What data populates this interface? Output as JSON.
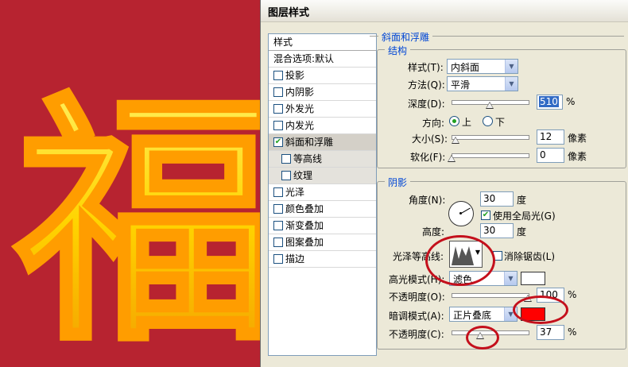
{
  "canvas": {
    "glyph": "福",
    "bg_color": "#b72330",
    "glyph_color": "#ffd400"
  },
  "dialog": {
    "title": "图层样式",
    "styles_list": {
      "header": "样式",
      "blend": "混合选项:默认",
      "items": [
        {
          "label": "投影",
          "checked": false
        },
        {
          "label": "内阴影",
          "checked": false
        },
        {
          "label": "外发光",
          "checked": false
        },
        {
          "label": "内发光",
          "checked": false
        },
        {
          "label": "斜面和浮雕",
          "checked": true
        },
        {
          "label": "等高线",
          "checked": false
        },
        {
          "label": "纹理",
          "checked": false
        },
        {
          "label": "光泽",
          "checked": false
        },
        {
          "label": "颜色叠加",
          "checked": false
        },
        {
          "label": "渐变叠加",
          "checked": false
        },
        {
          "label": "图案叠加",
          "checked": false
        },
        {
          "label": "描边",
          "checked": false
        }
      ]
    },
    "bevel": {
      "section_title": "斜面和浮雕",
      "structure_title": "结构",
      "style_label": "样式(T):",
      "style_value": "内斜面",
      "technique_label": "方法(Q):",
      "technique_value": "平滑",
      "depth_label": "深度(D):",
      "depth_value": "510",
      "depth_unit": "%",
      "depth_slider": 0.5,
      "direction_label": "方向:",
      "dir_up": "上",
      "dir_down": "下",
      "size_label": "大小(S):",
      "size_value": "12",
      "size_unit": "像素",
      "size_slider": 0.05,
      "soften_label": "软化(F):",
      "soften_value": "0",
      "soften_unit": "像素",
      "soften_slider": 0.0
    },
    "shading": {
      "title": "阴影",
      "angle_label": "角度(N):",
      "angle_value": "30",
      "angle_unit": "度",
      "global_light_label": "使用全局光(G)",
      "altitude_label": "高度:",
      "altitude_value": "30",
      "altitude_unit": "度",
      "gloss_label": "光泽等高线:",
      "antialias_label": "消除锯齿(L)",
      "highlight_mode_label": "高光模式(H):",
      "highlight_mode_value": "滤色",
      "highlight_color": "#ffffff",
      "highlight_opacity_label": "不透明度(O):",
      "highlight_opacity_value": "100",
      "highlight_opacity_slider": 1.0,
      "shadow_mode_label": "暗调模式(A):",
      "shadow_mode_value": "正片叠底",
      "shadow_color": "#ff0000",
      "shadow_opacity_label": "不透明度(C):",
      "shadow_opacity_value": "37",
      "shadow_opacity_slider": 0.37,
      "pct": "%"
    }
  }
}
